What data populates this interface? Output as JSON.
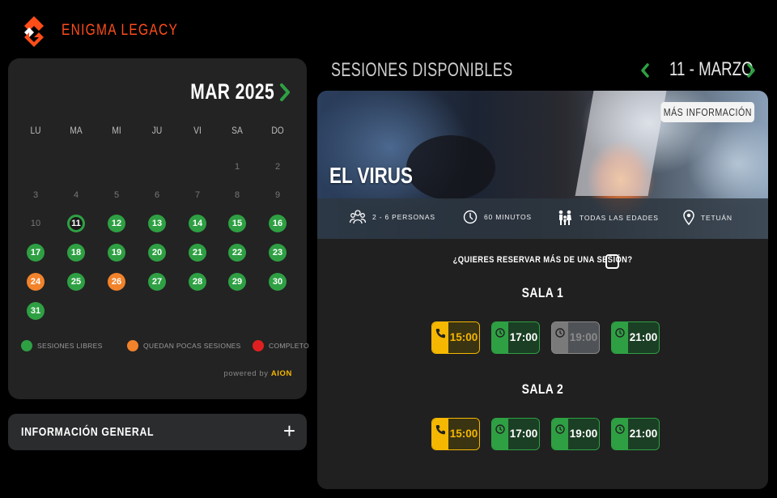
{
  "brand": {
    "name": "ENIGMA LEGACY",
    "logo": "enigma-logo-icon",
    "accent": "#ff4d1a"
  },
  "calendar": {
    "month_label": "MAR 2025",
    "weekdays": [
      "LU",
      "MA",
      "MI",
      "JU",
      "VI",
      "SA",
      "DO"
    ],
    "days": [
      {
        "n": "1",
        "s": "off"
      },
      {
        "n": "2",
        "s": "off"
      },
      {
        "n": "3",
        "s": "off"
      },
      {
        "n": "4",
        "s": "off"
      },
      {
        "n": "5",
        "s": "off"
      },
      {
        "n": "6",
        "s": "off"
      },
      {
        "n": "7",
        "s": "off"
      },
      {
        "n": "8",
        "s": "off"
      },
      {
        "n": "9",
        "s": "off"
      },
      {
        "n": "10",
        "s": "off"
      },
      {
        "n": "11",
        "s": "sel"
      },
      {
        "n": "12",
        "s": "g"
      },
      {
        "n": "13",
        "s": "g"
      },
      {
        "n": "14",
        "s": "g"
      },
      {
        "n": "15",
        "s": "g"
      },
      {
        "n": "16",
        "s": "g"
      },
      {
        "n": "17",
        "s": "g"
      },
      {
        "n": "18",
        "s": "g"
      },
      {
        "n": "19",
        "s": "g"
      },
      {
        "n": "20",
        "s": "g"
      },
      {
        "n": "21",
        "s": "g"
      },
      {
        "n": "22",
        "s": "g"
      },
      {
        "n": "23",
        "s": "g"
      },
      {
        "n": "24",
        "s": "o"
      },
      {
        "n": "25",
        "s": "g"
      },
      {
        "n": "26",
        "s": "o"
      },
      {
        "n": "27",
        "s": "g"
      },
      {
        "n": "28",
        "s": "g"
      },
      {
        "n": "29",
        "s": "g"
      },
      {
        "n": "30",
        "s": "g"
      },
      {
        "n": "31",
        "s": "g"
      }
    ],
    "first_weekday_index": 5,
    "legend": {
      "free": "SESIONES LIBRES",
      "few": "QUEDAN POCAS SESIONES",
      "full": "COMPLETO"
    },
    "powered_prefix": "powered by",
    "powered_brand": "AION"
  },
  "info_general": {
    "label": "INFORMACIÓN GENERAL",
    "toggle": "+"
  },
  "sessions": {
    "title": "SESIONES DISPONIBLES",
    "date_label": "11 - MARZO",
    "game": {
      "name": "EL VIRUS",
      "more_info": "MÁS INFORMACIÓN",
      "players": "2 - 6 PERSONAS",
      "duration": "60 MINUTOS",
      "ages": "TODAS LAS EDADES",
      "location": "TETUÁN"
    },
    "multi_question": "¿QUIERES RESERVAR MÁS DE UNA SESIÓN?",
    "rooms": [
      {
        "name": "SALA 1",
        "slots": [
          {
            "time": "15:00",
            "status": "few"
          },
          {
            "time": "17:00",
            "status": "free"
          },
          {
            "time": "19:00",
            "status": "full"
          },
          {
            "time": "21:00",
            "status": "free"
          }
        ]
      },
      {
        "name": "SALA 2",
        "slots": [
          {
            "time": "15:00",
            "status": "few"
          },
          {
            "time": "17:00",
            "status": "free"
          },
          {
            "time": "19:00",
            "status": "free"
          },
          {
            "time": "21:00",
            "status": "free"
          }
        ]
      }
    ]
  },
  "colors": {
    "free": "#2ea043",
    "few": "#f2832b",
    "full": "#e02020",
    "slot_few": "#f5b700"
  }
}
